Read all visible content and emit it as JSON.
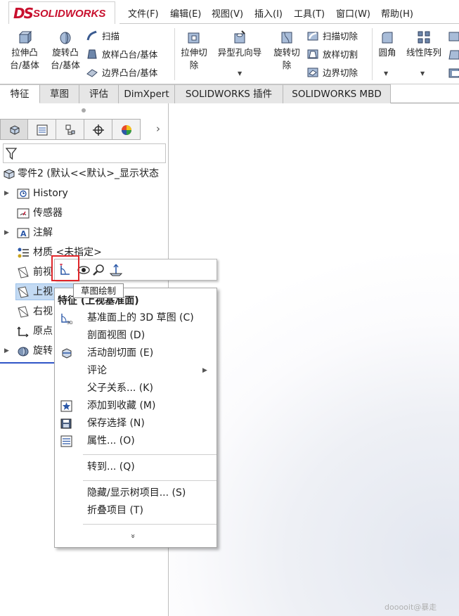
{
  "app": {
    "logo_text": "SOLIDWORKS",
    "logo_mark": "DS"
  },
  "menu": [
    "文件(F)",
    "编辑(E)",
    "视图(V)",
    "插入(I)",
    "工具(T)",
    "窗口(W)",
    "帮助(H)"
  ],
  "ribbon": {
    "extrude_boss": [
      "拉伸凸",
      "台/基体"
    ],
    "revolve_boss": [
      "旋转凸",
      "台/基体"
    ],
    "sweep": "扫描",
    "loft_boss": "放样凸台/基体",
    "boundary_boss": "边界凸台/基体",
    "extrude_cut": [
      "拉伸切",
      "除"
    ],
    "hole_wizard": "异型孔向导",
    "revolve_cut": [
      "旋转切",
      "除"
    ],
    "swept_cut": "扫描切除",
    "lofted_cut": "放样切割",
    "boundary_cut": "边界切除",
    "fillet": "圆角",
    "linear_pattern": "线性阵列"
  },
  "tabs": [
    "特征",
    "草图",
    "评估",
    "DimXpert",
    "SOLIDWORKS 插件",
    "SOLIDWORKS MBD"
  ],
  "tree": {
    "root": "零件2 (默认<<默认>_显示状态",
    "items": [
      "History",
      "传感器",
      "注解",
      "材质 <未指定>",
      "前视",
      "上视",
      "右视",
      "原点",
      "旋转"
    ]
  },
  "tooltip": "草图绘制",
  "context_menu": {
    "title": "特征 (上视基准面)",
    "items": [
      "基准面上的 3D 草图 (C)",
      "剖面视图 (D)",
      "活动剖切面 (E)",
      "评论",
      "父子关系... (K)",
      "添加到收藏 (M)",
      "保存选择 (N)",
      "属性... (O)",
      "转到... (Q)",
      "隐藏/显示树项目... (S)",
      "折叠项目 (T)"
    ],
    "more": "»"
  },
  "watermark": "dooooit@暴走",
  "colors": {
    "brand_red": "#c8102e",
    "selection": "#cfe3f7",
    "highlight_box": "#e0262a"
  }
}
